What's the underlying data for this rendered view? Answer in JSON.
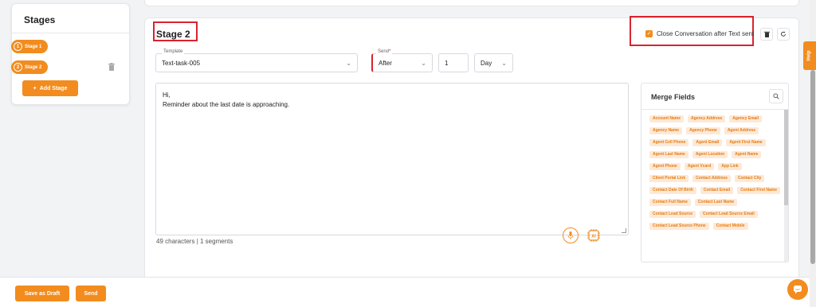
{
  "sidebar": {
    "title": "Stages",
    "stages": [
      {
        "num": "1",
        "label": "Stage 1"
      },
      {
        "num": "2",
        "label": "Stage 2"
      }
    ],
    "add_label": "Add Stage"
  },
  "stage": {
    "title": "Stage 2",
    "close_conversation": {
      "label": "Close Conversation after Text sent",
      "checked": true
    }
  },
  "template": {
    "label": "Template",
    "value": "Text-task-005"
  },
  "send": {
    "label": "Send",
    "timing": "After",
    "amount": "1",
    "unit": "Day"
  },
  "message": {
    "lines": [
      "Hi,",
      "Reminder about the last date is approaching."
    ],
    "char_count": "49 characters | 1 segments"
  },
  "merge_fields": {
    "title": "Merge Fields",
    "items": [
      "Account Name",
      "Agency Address",
      "Agency Email",
      "Agency Name",
      "Agency Phone",
      "Agent Address",
      "Agent Cell Phone",
      "Agent Email",
      "Agent First Name",
      "Agent Last Name",
      "Agent Location",
      "Agent Name",
      "Agent Phone",
      "Agent Vcard",
      "App Link",
      "Client Portal Link",
      "Contact Address",
      "Contact City",
      "Contact Date Of Birth",
      "Contact Email",
      "Contact First Name",
      "Contact Full Name",
      "Contact Last Name",
      "Contact Lead Source",
      "Contact Lead Source Email",
      "Contact Lead Source Phone",
      "Contact Mobile"
    ]
  },
  "help_label": "Help",
  "footer": {
    "save_draft": "Save as Draft",
    "send": "Send"
  },
  "colors": {
    "accent": "#f28c1e",
    "highlight": "#d9232d",
    "chip_bg": "#fde9d6"
  }
}
